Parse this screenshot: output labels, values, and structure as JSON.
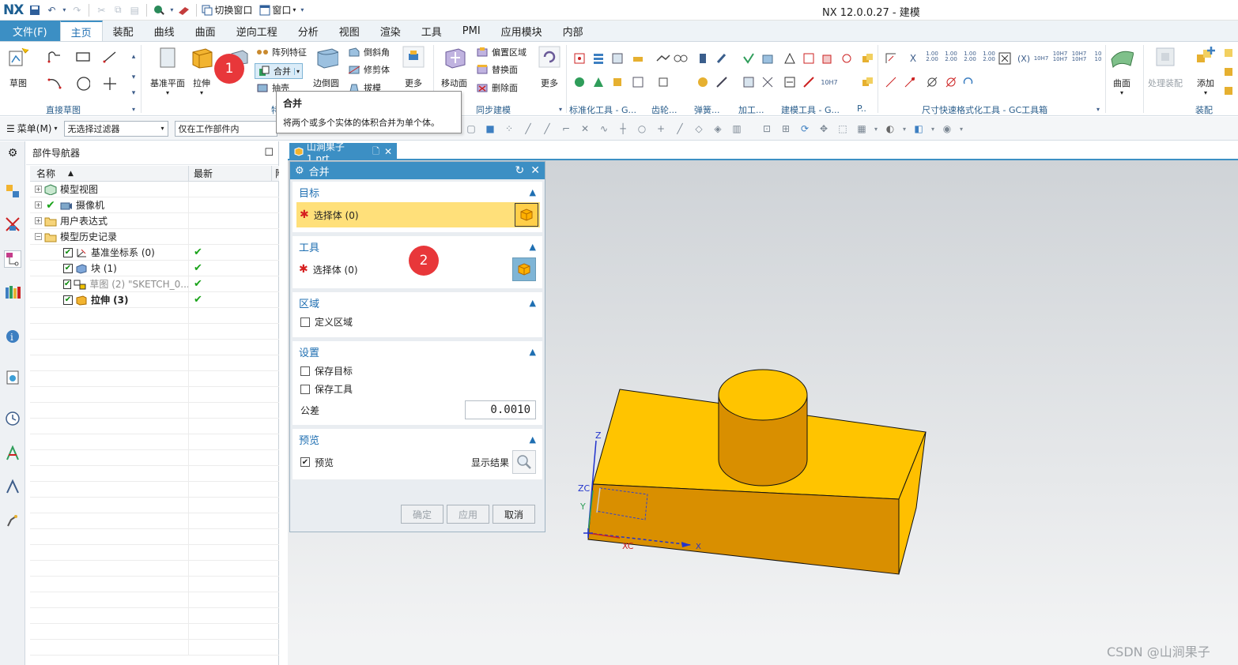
{
  "app": {
    "logo": "NX",
    "title": "NX 12.0.0.27 - 建模",
    "quick_access": {
      "switch_window": "切换窗口",
      "window": "窗口"
    }
  },
  "tabs": [
    {
      "label": "文件(F)"
    },
    {
      "label": "主页"
    },
    {
      "label": "装配"
    },
    {
      "label": "曲线"
    },
    {
      "label": "曲面"
    },
    {
      "label": "逆向工程"
    },
    {
      "label": "分析"
    },
    {
      "label": "视图"
    },
    {
      "label": "渲染"
    },
    {
      "label": "工具"
    },
    {
      "label": "PMI"
    },
    {
      "label": "应用模块"
    },
    {
      "label": "内部"
    }
  ],
  "ribbon": {
    "sketch": "草图",
    "datum_plane": "基准平面",
    "extrude": "拉伸",
    "pattern_feature": "阵列特征",
    "unite": "合并",
    "shell": "抽壳",
    "edge_blend": "边倒圆",
    "chamfer": "倒斜角",
    "trim_body": "修剪体",
    "draft": "拔模",
    "more": "更多",
    "move_face": "移动面",
    "offset_region": "偏置区域",
    "replace_face": "替换面",
    "delete_face": "删除面",
    "more2": "更多",
    "surface": "曲面",
    "process_assembly": "处理装配",
    "add": "添加",
    "groups": {
      "direct_sketch": "直接草图",
      "feature": "特",
      "sync_modeling": "同步建模",
      "std_tools": "标准化工具 - G...",
      "gear": "齿轮...",
      "spring": "弹簧...",
      "machining": "加工...",
      "modeling_tools": "建模工具 - G...",
      "p": "P..",
      "dim_format": "尺寸快速格式化工具 - GC工具箱",
      "assembly": "装配"
    }
  },
  "tooltip": {
    "title": "合并",
    "desc": "将两个或多个实体的体积合并为单个体。"
  },
  "selection_bar": {
    "menu": "菜单(M)",
    "filter": "无选择过滤器",
    "scope": "仅在工作部件内"
  },
  "navigator": {
    "title": "部件导航器",
    "col_name": "名称",
    "col_latest": "最新",
    "col_extra": "附",
    "rows": [
      {
        "label": "模型视图",
        "latest": ""
      },
      {
        "label": "摄像机",
        "latest": ""
      },
      {
        "label": "用户表达式",
        "latest": ""
      },
      {
        "label": "模型历史记录",
        "latest": ""
      },
      {
        "label": "基准坐标系 (0)",
        "latest": "✔"
      },
      {
        "label": "块 (1)",
        "latest": "✔"
      },
      {
        "label": "草图 (2) \"SKETCH_0...",
        "latest": "✔"
      },
      {
        "label": "拉伸 (3)",
        "latest": "✔"
      }
    ]
  },
  "document": {
    "tab_label": "山涧果子1.prt"
  },
  "dialog": {
    "title": "合并",
    "target": {
      "header": "目标",
      "select": "选择体 (0)"
    },
    "tool": {
      "header": "工具",
      "select": "选择体 (0)"
    },
    "region": {
      "header": "区域",
      "define": "定义区域"
    },
    "settings": {
      "header": "设置",
      "keep_target": "保存目标",
      "keep_tool": "保存工具",
      "tolerance_label": "公差",
      "tolerance_value": "0.0010"
    },
    "preview": {
      "header": "预览",
      "preview": "预览",
      "show_result": "显示结果"
    },
    "buttons": {
      "ok": "确定",
      "apply": "应用",
      "cancel": "取消"
    }
  },
  "markers": {
    "m1": "1",
    "m2": "2"
  },
  "axes": {
    "z": "Z",
    "zc": "ZC",
    "y": "Y",
    "xc": "XC",
    "x": "X"
  },
  "watermark": "CSDN @山涧果子",
  "colors": {
    "accent": "#3c8fc4",
    "part_top": "#ffc400",
    "part_side": "#d98f00",
    "marker": "#e8373a"
  }
}
